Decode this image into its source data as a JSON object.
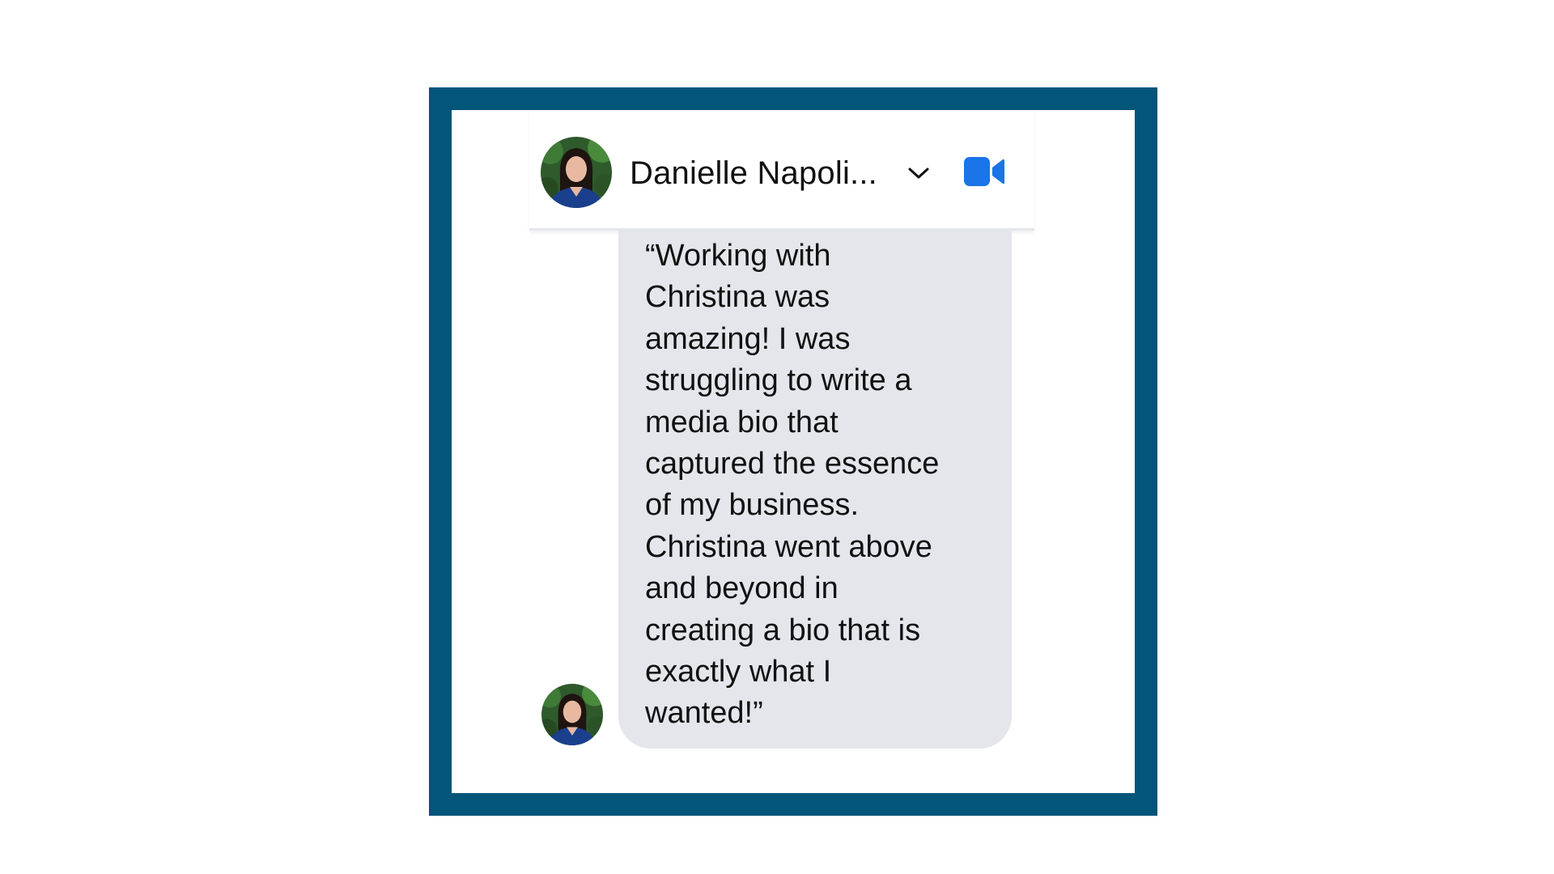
{
  "contact": {
    "name": "Danielle Napoli...",
    "avatar_icon": "profile-photo",
    "dropdown_icon": "chevron-down-icon",
    "call_icon": "video-call-icon"
  },
  "message": {
    "text": "“Working with\nChristina was\namazing! I was\nstruggling to write a\nmedia bio that\ncaptured the essence\nof my business.\nChristina went above\nand beyond in\ncreating a bio that is\nexactly what I\nwanted!”",
    "sender_avatar_icon": "profile-photo"
  },
  "colors": {
    "frame": "#04557a",
    "bubble": "#e4e6eb",
    "accent": "#1b74e8"
  }
}
